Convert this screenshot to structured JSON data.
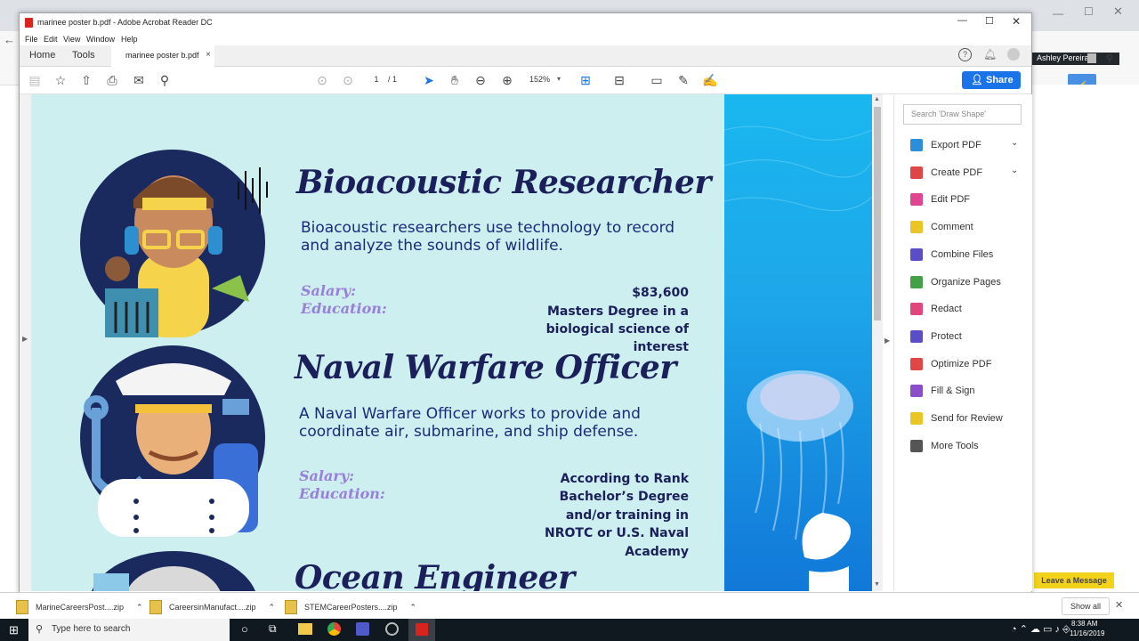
{
  "acrobat": {
    "title": "marinee poster b.pdf - Adobe Acrobat Reader DC",
    "menu": [
      "File",
      "Edit",
      "View",
      "Window",
      "Help"
    ],
    "nav_tabs": [
      "Home",
      "Tools"
    ],
    "doc_tab": "marinee poster b.pdf",
    "page_current": "1",
    "page_total": "/ 1",
    "zoom": "152%",
    "share_label": "Share",
    "search_placeholder": "Search 'Draw Shape'"
  },
  "tools": [
    {
      "label": "Export PDF",
      "color": "#2a8fd7",
      "icon": "export-pdf-icon",
      "chevron": true
    },
    {
      "label": "Create PDF",
      "color": "#e04646",
      "icon": "create-pdf-icon",
      "chevron": true
    },
    {
      "label": "Edit PDF",
      "color": "#e04690",
      "icon": "edit-pdf-icon",
      "chevron": false
    },
    {
      "label": "Comment",
      "color": "#e8c626",
      "icon": "comment-icon",
      "chevron": false
    },
    {
      "label": "Combine Files",
      "color": "#5a4ec8",
      "icon": "combine-files-icon",
      "chevron": false
    },
    {
      "label": "Organize Pages",
      "color": "#43a047",
      "icon": "organize-pages-icon",
      "chevron": false
    },
    {
      "label": "Redact",
      "color": "#e0457b",
      "icon": "redact-icon",
      "chevron": false
    },
    {
      "label": "Protect",
      "color": "#5a4ec8",
      "icon": "protect-icon",
      "chevron": false
    },
    {
      "label": "Optimize PDF",
      "color": "#e04646",
      "icon": "optimize-pdf-icon",
      "chevron": false
    },
    {
      "label": "Fill & Sign",
      "color": "#8a4ec8",
      "icon": "fill-sign-icon",
      "chevron": false
    },
    {
      "label": "Send for Review",
      "color": "#e8c626",
      "icon": "send-review-icon",
      "chevron": false
    },
    {
      "label": "More Tools",
      "color": "#555555",
      "icon": "more-tools-icon",
      "chevron": false
    }
  ],
  "poster": {
    "careers": [
      {
        "title": "Bioacoustic Researcher",
        "description_line1": "Bioacoustic researchers use technology to record",
        "description_line2": "and analyze the sounds of wildlife.",
        "salary_label": "Salary:",
        "education_label": "Education:",
        "salary": "$83,600",
        "education_lines": [
          "Masters Degree in a",
          "biological science of",
          "interest"
        ]
      },
      {
        "title": "Naval Warfare Officer",
        "description_line1": "A Naval Warfare Officer works to provide and",
        "description_line2": "coordinate air, submarine, and ship defense.",
        "salary_label": "Salary:",
        "education_label": "Education:",
        "salary": "According to Rank",
        "education_lines": [
          "Bachelor’s Degree",
          "and/or training in",
          "NROTC or U.S. Naval",
          "Academy"
        ]
      },
      {
        "title": "Ocean Engineer"
      }
    ]
  },
  "browser": {
    "user_name": "Ashley Pereira",
    "leave_message": "Leave a Message"
  },
  "downloads": {
    "items": [
      "MarineCareersPost....zip",
      "CareersinManufact....zip",
      "STEMCareerPosters....zip"
    ],
    "show_all": "Show all"
  },
  "taskbar": {
    "search_placeholder": "Type here to search",
    "time": "8:38 AM",
    "date": "11/16/2019"
  },
  "colors": {
    "poster_bg": "#cdeff0",
    "heading": "#1b1f5a",
    "label": "#9a7fd8",
    "share_button": "#1a73e8"
  }
}
